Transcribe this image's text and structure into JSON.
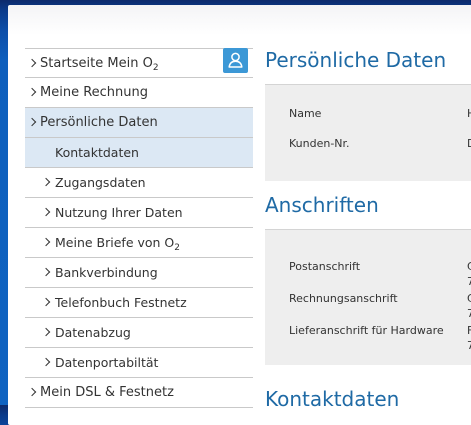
{
  "sidebar": {
    "items": [
      {
        "label": "Startseite Mein O",
        "sub": "2"
      },
      {
        "label": "Meine Rechnung"
      },
      {
        "label": "Persönliche Daten"
      },
      {
        "label": "Kontaktdaten"
      },
      {
        "label": "Zugangsdaten"
      },
      {
        "label": "Nutzung Ihrer Daten"
      },
      {
        "label": "Meine Briefe von O",
        "sub": "2"
      },
      {
        "label": "Bankverbindung"
      },
      {
        "label": "Telefonbuch Festnetz"
      },
      {
        "label": "Datenabzug"
      },
      {
        "label": "Datenportabiltät"
      },
      {
        "label": "Mein DSL & Festnetz"
      }
    ],
    "user_icon": "user-icon"
  },
  "main": {
    "section1": {
      "title": "Persönliche Daten",
      "rows": [
        {
          "label": "Name",
          "value": "H"
        },
        {
          "label": "Kunden-Nr.",
          "value": "D"
        }
      ]
    },
    "section2": {
      "title": "Anschriften",
      "rows": [
        {
          "label": "Postanschrift",
          "value": "C",
          "value2": "7"
        },
        {
          "label": "Rechnungsanschrift",
          "value": "C",
          "value2": "7"
        },
        {
          "label": "Lieferanschrift für Hardware",
          "value": "F",
          "value2": "7"
        }
      ]
    },
    "section3": {
      "title": "Kontaktdaten"
    }
  },
  "colors": {
    "accent": "#1f6aa5",
    "active_bg": "#dce8f4",
    "user_button": "#3c98d6"
  }
}
